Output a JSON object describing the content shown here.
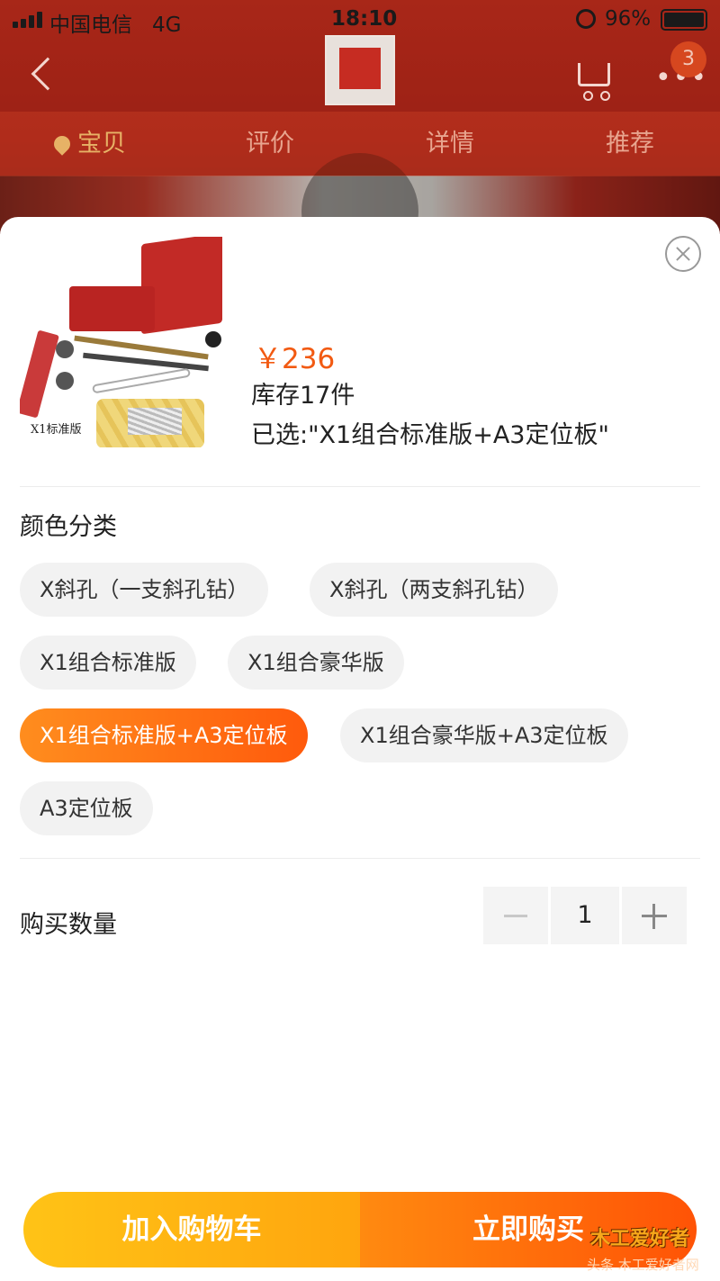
{
  "status_bar": {
    "carrier": "中国电信",
    "network": "4G",
    "time": "18:10",
    "battery": "96%"
  },
  "nav": {
    "cart_badge": "3",
    "tabs": [
      "宝贝",
      "评价",
      "详情",
      "推荐"
    ],
    "active_tab": "宝贝"
  },
  "product": {
    "image_caption": "X1标准版",
    "price": "￥236",
    "stock": "库存17件",
    "selected": "已选:\"X1组合标准版+A3定位板\""
  },
  "color_section": {
    "title": "颜色分类",
    "options": [
      "X斜孔（一支斜孔钻）",
      "X斜孔（两支斜孔钻）",
      "X1组合标准版",
      "X1组合豪华版",
      "X1组合标准版+A3定位板",
      "X1组合豪华版+A3定位板",
      "A3定位板"
    ],
    "selected_option": "X1组合标准版+A3定位板"
  },
  "quantity": {
    "title": "购买数量",
    "value": "1"
  },
  "actions": {
    "add_to_cart": "加入购物车",
    "buy_now": "立即购买"
  },
  "watermark": {
    "logo": "木工爱好者",
    "source": "头条 木工爱好者网"
  },
  "colors": {
    "accent": "#ff5a0c",
    "price": "#f25a12",
    "add_cart": "#ffb313",
    "buy_now": "#ff6a0a"
  }
}
